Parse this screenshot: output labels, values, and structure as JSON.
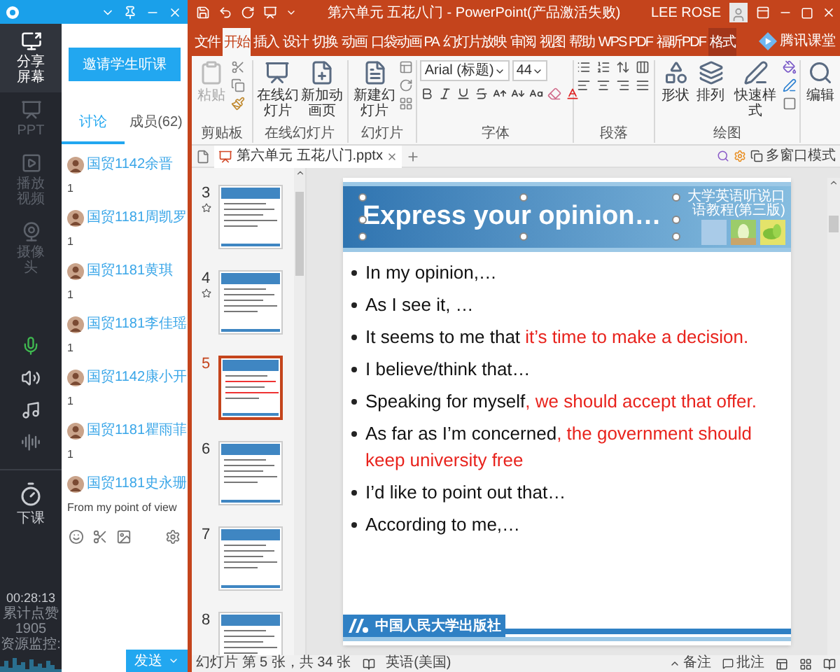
{
  "sidebar": {
    "items": [
      {
        "label": "分享屏幕",
        "kind": "screen",
        "selected": true
      },
      {
        "label": "PPT",
        "kind": "ppt",
        "selected": false
      },
      {
        "label": "播放视频",
        "kind": "video",
        "selected": false
      },
      {
        "label": "摄像头",
        "kind": "camera",
        "selected": false
      }
    ],
    "end_class": "下课",
    "timer": "00:28:13",
    "stats": [
      "累计点赞",
      "1905",
      "资源监控:"
    ]
  },
  "chat": {
    "invite_button": "邀请学生听课",
    "tabs": [
      {
        "label": "讨论",
        "selected": true
      },
      {
        "label": "成员(62)",
        "selected": false
      }
    ],
    "messages": [
      {
        "sender": "国贸1142余晋",
        "text": "1"
      },
      {
        "sender": "国贸1181周凯罗",
        "text": "1"
      },
      {
        "sender": "国贸1181黄琪",
        "text": "1"
      },
      {
        "sender": "国贸1181李佳瑶",
        "text": "1"
      },
      {
        "sender": "国贸1142康小开",
        "text": "1"
      },
      {
        "sender": "国贸1181瞿雨菲",
        "text": "1"
      },
      {
        "sender": "国贸1181史永珊",
        "text": "From my point of view"
      }
    ],
    "send_button": "发送"
  },
  "powerpoint": {
    "title": "第六单元 五花八门 - PowerPoint(产品激活失败)",
    "user": "LEE ROSE",
    "overlay_logo": "腾讯课堂",
    "ribbon_tabs": [
      {
        "label": "文件",
        "selected": false,
        "kind": "normal"
      },
      {
        "label": "开始",
        "selected": true,
        "kind": "normal"
      },
      {
        "label": "插入",
        "selected": false,
        "kind": "normal"
      },
      {
        "label": "设计",
        "selected": false,
        "kind": "normal"
      },
      {
        "label": "切换",
        "selected": false,
        "kind": "normal"
      },
      {
        "label": "动画",
        "selected": false,
        "kind": "normal"
      },
      {
        "label": "口袋动画 PA",
        "selected": false,
        "kind": "normal"
      },
      {
        "label": "幻灯片放映",
        "selected": false,
        "kind": "normal"
      },
      {
        "label": "审阅",
        "selected": false,
        "kind": "normal"
      },
      {
        "label": "视图",
        "selected": false,
        "kind": "normal"
      },
      {
        "label": "帮助",
        "selected": false,
        "kind": "normal"
      },
      {
        "label": "WPS PDF",
        "selected": false,
        "kind": "normal"
      },
      {
        "label": "福昕PDF",
        "selected": false,
        "kind": "normal"
      },
      {
        "label": "格式",
        "selected": false,
        "kind": "contextual"
      }
    ],
    "ribbon": {
      "paste": {
        "label": "粘贴",
        "disabled": true
      },
      "clipboard_label": "剪贴板",
      "online": [
        "在线幻灯片",
        "新加动画页"
      ],
      "online_label": "在线幻灯片",
      "new_slide": "新建幻灯片",
      "slides_label": "幻灯片",
      "font_name": "Arial (标题)",
      "font_size": "44",
      "font_label": "字体",
      "paragraph_label": "段落",
      "drawing": [
        "形状",
        "排列",
        "快速样式"
      ],
      "drawing_label": "绘图",
      "edit": "编辑"
    },
    "doc_tab": "第六单元 五花八门.pptx",
    "multi_window": "多窗口模式",
    "thumbnails": [
      {
        "number": "3",
        "animated": true,
        "selected": false
      },
      {
        "number": "4",
        "animated": true,
        "selected": false
      },
      {
        "number": "5",
        "animated": false,
        "selected": true
      },
      {
        "number": "6",
        "animated": false,
        "selected": false
      },
      {
        "number": "7",
        "animated": false,
        "selected": false
      },
      {
        "number": "8",
        "animated": false,
        "selected": false
      }
    ],
    "slide": {
      "series_label": "大学英语听说口语教程(第三版)",
      "title": "Express your opinion…",
      "bullets": [
        {
          "text": "In my opinion,…"
        },
        {
          "text": "As I see it, …"
        },
        {
          "text": "It seems to me that ",
          "highlight": "it’s time to make a decision."
        },
        {
          "text": "I believe/think that…"
        },
        {
          "text": "Speaking for myself",
          "highlight": ", we should accept that offer."
        },
        {
          "text": "As far as I’m concerned",
          "highlight": ", the government should keep university free"
        },
        {
          "text": "I’d like to point out that…"
        },
        {
          "text": "According to me,…"
        }
      ],
      "publisher": "中国人民大学出版社"
    },
    "status_bar": {
      "slide_info": "幻灯片 第 5 张，共 34 张",
      "language": "英语(美国)",
      "notes": "备注",
      "comments": "批注"
    }
  }
}
